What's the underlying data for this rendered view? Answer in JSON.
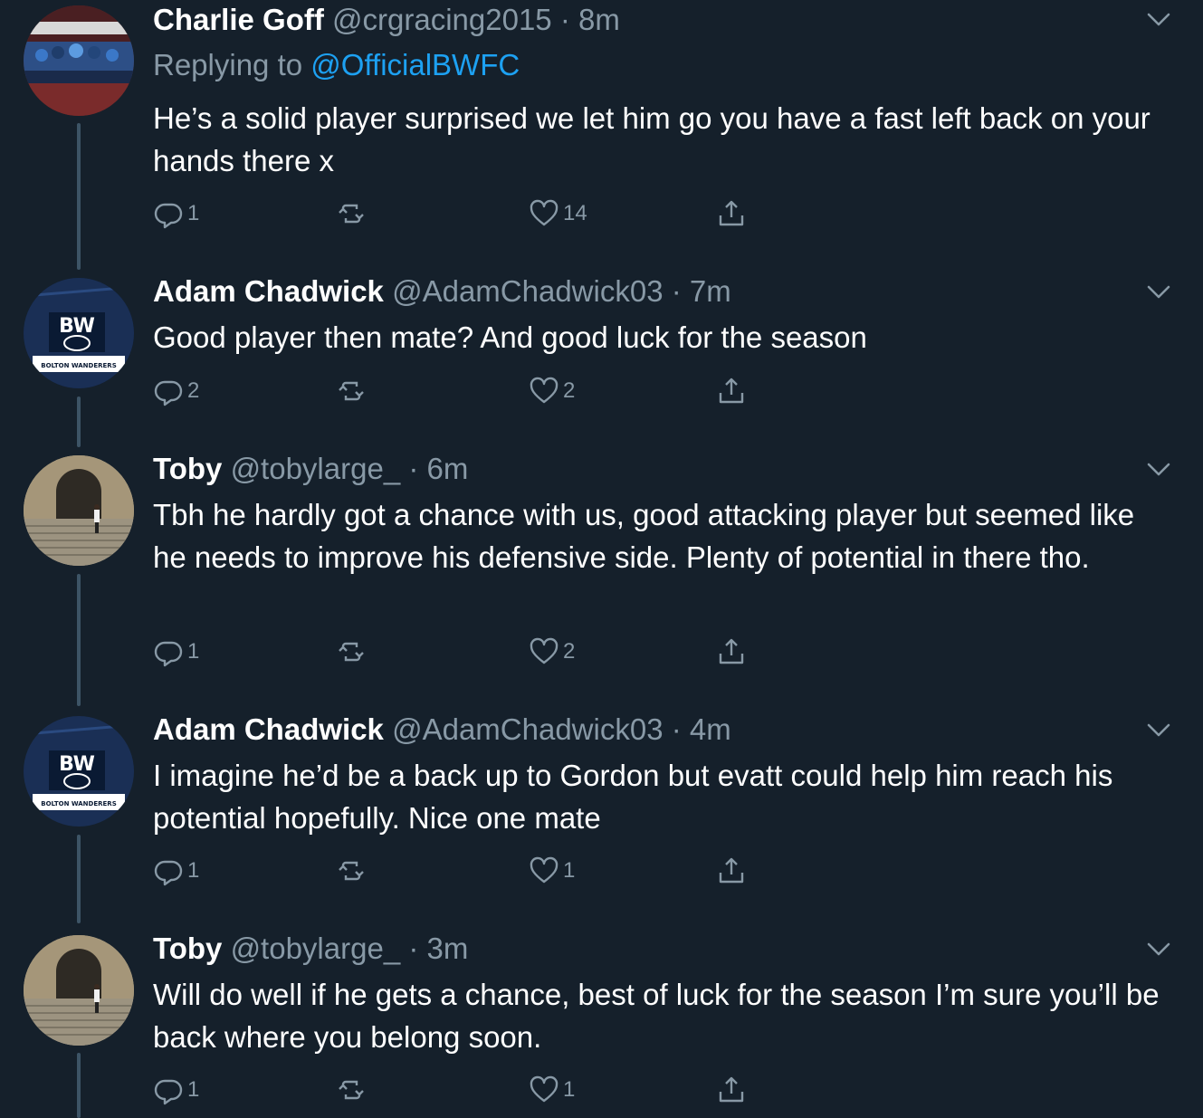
{
  "tweets": [
    {
      "name": "Charlie Goff",
      "handle": "@crgracing2015",
      "dot": "·",
      "time": "8m",
      "replying_prefix": "Replying to",
      "replying_to": "@OfficialBWFC",
      "text": "He’s a solid player surprised we let him go you have a fast left back on your hands there x",
      "replies": "1",
      "likes": "14",
      "avatar": "stadium-team-photo"
    },
    {
      "name": "Adam Chadwick",
      "handle": "@AdamChadwick03",
      "dot": "·",
      "time": "7m",
      "text": "Good player then mate? And good luck for the season",
      "replies": "2",
      "likes": "2",
      "avatar": "bolton-wanderers-crest",
      "avatar_caption": "BOLTON WANDERERS"
    },
    {
      "name": "Toby",
      "handle": "@tobylarge_",
      "dot": "·",
      "time": "6m",
      "text": "Tbh he hardly got a chance with us, good attacking player but seemed like he needs to improve his defensive side. Plenty of potential in there tho.",
      "replies": "1",
      "likes": "2",
      "avatar": "steps-archway-photo"
    },
    {
      "name": "Adam Chadwick",
      "handle": "@AdamChadwick03",
      "dot": "·",
      "time": "4m",
      "text": "I imagine he’d be a back up to Gordon but evatt could help him reach his potential hopefully. Nice one mate",
      "replies": "1",
      "likes": "1",
      "avatar": "bolton-wanderers-crest",
      "avatar_caption": "BOLTON WANDERERS"
    },
    {
      "name": "Toby",
      "handle": "@tobylarge_",
      "dot": "·",
      "time": "3m",
      "text": "Will do well if he gets a chance, best of luck for the season I’m sure you’ll be back where you belong soon.",
      "replies": "1",
      "likes": "1",
      "avatar": "steps-archway-photo"
    }
  ],
  "colors": {
    "background": "#15202b",
    "secondary_text": "#8899a6",
    "link": "#1da1f2",
    "thread_line": "#3d5466"
  },
  "icons": {
    "reply": "reply-icon",
    "retweet": "retweet-icon",
    "like": "like-icon",
    "share": "share-icon",
    "menu": "chevron-down-icon"
  }
}
